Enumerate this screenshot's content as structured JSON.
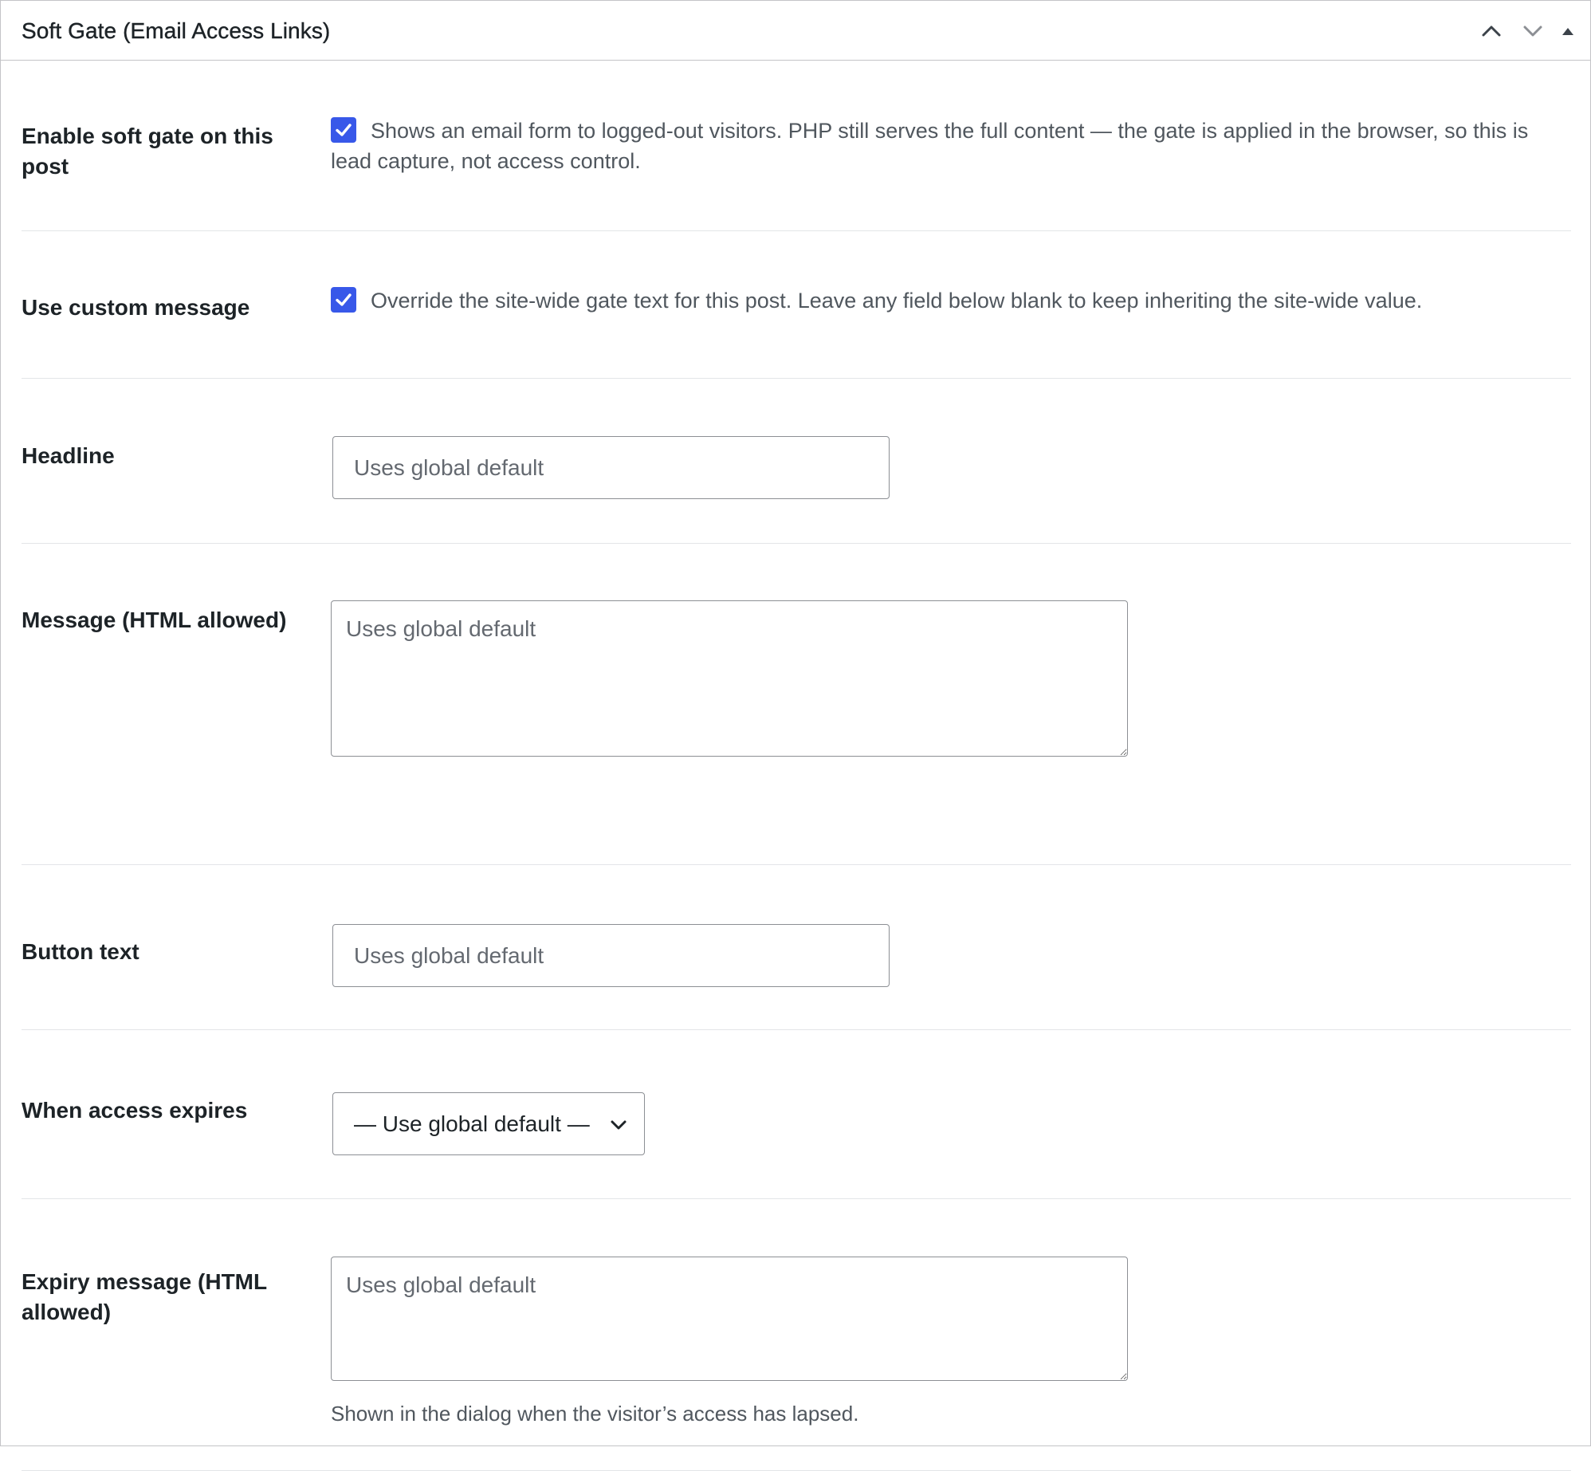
{
  "metabox": {
    "title": "Soft Gate (Email Access Links)",
    "actions": {
      "move_up_icon": "chevron-up-icon",
      "move_down_icon": "chevron-down-icon",
      "toggle_icon": "triangle-up-icon"
    }
  },
  "fields": {
    "enable": {
      "label": "Enable soft gate on this post",
      "checked": true,
      "description": "Shows an email form to logged-out visitors. PHP still serves the full content — the gate is applied in the browser, so this is lead capture, not access control."
    },
    "custom_message": {
      "label": "Use custom message",
      "checked": true,
      "description": "Override the site-wide gate text for this post. Leave any field below blank to keep inheriting the site-wide value."
    },
    "headline": {
      "label": "Headline",
      "value": "",
      "placeholder": "Uses global default"
    },
    "message": {
      "label": "Message (HTML allowed)",
      "value": "",
      "placeholder": "Uses global default"
    },
    "button_text": {
      "label": "Button text",
      "value": "",
      "placeholder": "Uses global default"
    },
    "expires": {
      "label": "When access expires",
      "selected": "— Use global default —"
    },
    "expiry_message": {
      "label": "Expiry message (HTML allowed)",
      "value": "",
      "placeholder": "Uses global default",
      "description": "Shown in the dialog when the visitor’s access has lapsed."
    }
  },
  "colors": {
    "checkbox_accent": "#3858e9",
    "border": "#c3c4c7",
    "input_border": "#8c8f94",
    "muted_text": "#50575e"
  }
}
